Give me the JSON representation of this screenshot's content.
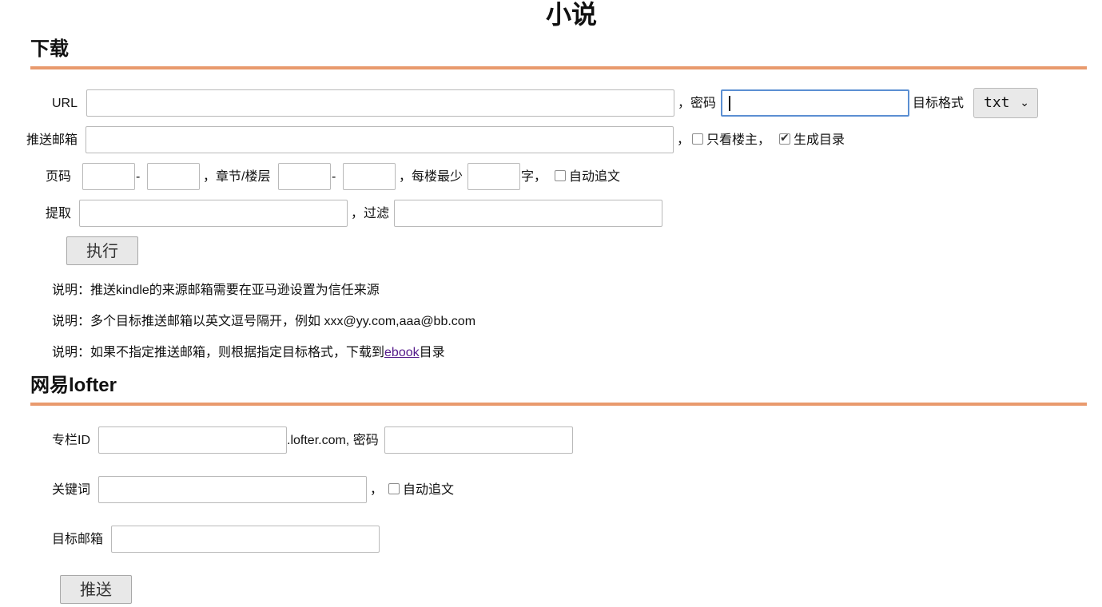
{
  "page": {
    "title": "小说"
  },
  "download": {
    "title": "下载",
    "url_label": "URL",
    "url_value": "",
    "password_label": "，密码",
    "password_value": "",
    "format_label": "目标格式",
    "format_selected": "txt",
    "email_label": "推送邮箱",
    "email_value": "",
    "comma": "，",
    "only_op_label": "只看楼主，",
    "only_op_checked": false,
    "gen_toc_label": "生成目录",
    "gen_toc_checked": true,
    "page_label": "页码",
    "page_from": "",
    "dash": "-",
    "page_to": "",
    "chapter_label": "，章节/楼层",
    "chapter_from": "",
    "chapter_to": "",
    "min_words_label": "，每楼最少",
    "min_words_value": "",
    "char_unit": "字，",
    "auto_follow_label": "自动追文",
    "auto_follow_checked": false,
    "extract_label": "提取",
    "extract_value": "",
    "filter_label": "，过滤",
    "filter_value": "",
    "execute_button": "执行",
    "note1": "说明：推送kindle的来源邮箱需要在亚马逊设置为信任来源",
    "note2": "说明：多个目标推送邮箱以英文逗号隔开，例如 xxx@yy.com,aaa@bb.com",
    "note3_prefix": "说明：如果不指定推送邮箱，则根据指定目标格式，下载到",
    "note3_link": "ebook",
    "note3_suffix": "目录"
  },
  "lofter": {
    "title": "网易lofter",
    "column_id_label": "专栏ID",
    "column_id_value": "",
    "domain_label": ".lofter.com, 密码",
    "password_value": "",
    "keyword_label": "关键词",
    "keyword_value": "",
    "comma": "，",
    "auto_follow_label": "自动追文",
    "auto_follow_checked": false,
    "target_email_label": "目标邮箱",
    "target_email_value": "",
    "push_button": "推送"
  },
  "colors": {
    "rule": "#e99a6d",
    "focus": "#5b8fd2",
    "link": "#551a8b"
  }
}
